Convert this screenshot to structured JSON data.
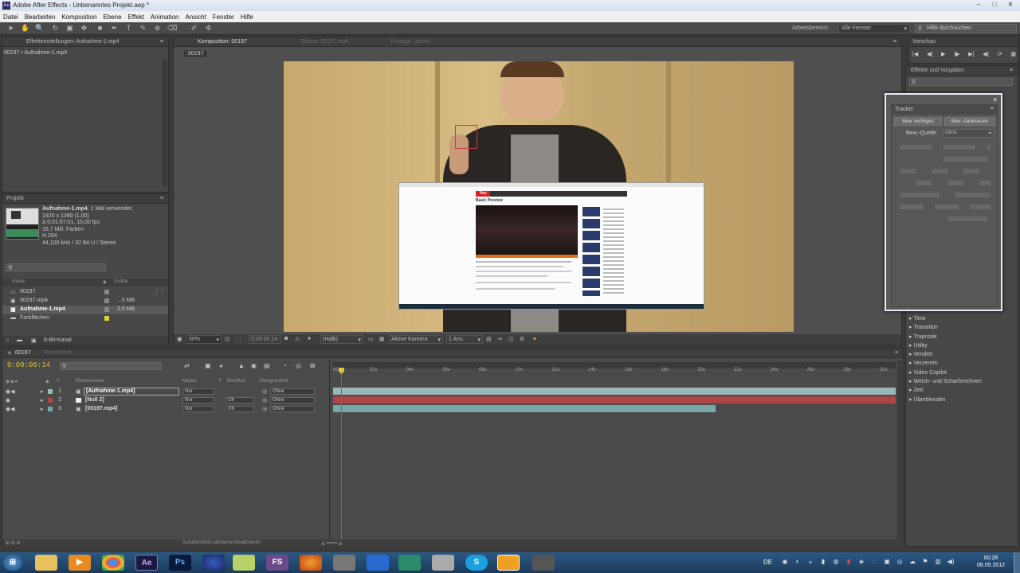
{
  "window": {
    "title": "Adobe After Effects - Unbenanntes Projekt.aep *",
    "app_icon": "Ae",
    "buttons": [
      "–",
      "□",
      "✕"
    ]
  },
  "menu": [
    "Datei",
    "Bearbeiten",
    "Komposition",
    "Ebene",
    "Effekt",
    "Animation",
    "Ansicht",
    "Fenster",
    "Hilfe"
  ],
  "toolbar": {
    "workspace_label": "Arbeitsbereich:",
    "workspace_value": "Alle Fenster",
    "help_placeholder": "Hilfe durchsuchen"
  },
  "effects_panel": {
    "tab": "Effekteinstellungen: Aufnahme-1.mp4",
    "subtitle": "00197 • Aufnahme-1.mp4"
  },
  "project": {
    "tab": "Projekt",
    "selected_name": "Aufnahme-1.mp4",
    "selected_usage": ", 1 Mal verwendet",
    "info": [
      "1920 x 1080 (1,00)",
      "Δ 0:01:07:01, 15,00 fps",
      "16,7 Mill. Farben",
      "H.264",
      "44,100 kHz / 32 Bit U / Stereo"
    ],
    "col_name": "Name",
    "col_size": "Größe",
    "items": [
      {
        "name": "00197",
        "size": ""
      },
      {
        "name": "00197.mp4",
        "size": "...5 MB"
      },
      {
        "name": "Aufnahme-1.mp4",
        "size": "3,5 MB"
      },
      {
        "name": "Farbflächen",
        "size": ""
      }
    ],
    "bit_depth": "8-Bit-Kanal"
  },
  "composition": {
    "tab": "Komposition: 00197",
    "tab2": "Ebene: 00197.mp4",
    "tab3": "Footage: (ohne)",
    "subtab": "00197",
    "zoom": "50%",
    "timecode": "0:00:00:14",
    "quality": "(Halb)",
    "camera": "Aktive Kamera",
    "views": "1 Ans.",
    "preview_site_title": "Basic Preview",
    "preview_logo": "You"
  },
  "preview_panel": {
    "tab": "Vorschau",
    "buttons": [
      "|◀",
      "◀|",
      "▶",
      "|▶",
      "▶|",
      "◀)",
      "⟳",
      "▦"
    ]
  },
  "effects_presets": {
    "tab": "Effekte und Vorgaben",
    "categories": [
      "Time",
      "Transition",
      "Trapcode",
      "Utility",
      "Veraltet",
      "Verzerren",
      "Video Copilot",
      "Weich- und Scharfzeichnen",
      "Zeit",
      "Überblenden"
    ]
  },
  "tracker": {
    "tab": "Tracker",
    "btn_track": "Bew. verfolgen",
    "btn_stabilize": "Bew. stabilisieren",
    "source_label": "Bew.-Quelle:",
    "source_value": "Ohne"
  },
  "timeline": {
    "tab": "00197",
    "tab2": "Renderliste",
    "timecode": "0:00:00:14",
    "col_layer": "Ebenenname",
    "col_mode": "Modus",
    "col_t": "T",
    "col_bewmas": "BewMas",
    "col_parent": "Übergeordnet",
    "ruler": [
      "00s",
      "02s",
      "04s",
      "06s",
      "08s",
      "10s",
      "12s",
      "14s",
      "16s",
      "18s",
      "20s",
      "22s",
      "24s",
      "26s",
      "28s",
      "30s"
    ],
    "layers": [
      {
        "num": "1",
        "name": "[Aufnahme-1.mp4]",
        "mode": "Nor",
        "bewmas": "",
        "parent": "Ohne",
        "color": "#9ab8b8"
      },
      {
        "num": "2",
        "name": "[Null 2]",
        "mode": "Nor",
        "bewmas": "Oh",
        "parent": "Ohne",
        "color": "#b04545"
      },
      {
        "num": "3",
        "name": "[00197.mp4]",
        "mode": "Nor",
        "bewmas": "Oh",
        "parent": "Ohne",
        "color": "#7aa7a7"
      }
    ],
    "footer": "Schalter/Modi aktivieren/deaktivieren"
  },
  "taskbar": {
    "apps": [
      "start-icon",
      "explorer-icon",
      "media-player-icon",
      "chrome-icon",
      "after-effects-icon",
      "photoshop-icon",
      "firefox-icon",
      "notepad-icon",
      "fraps-icon",
      "audacity-icon",
      "game-icon",
      "app-icon",
      "terminal-icon",
      "tool-icon",
      "skype-icon",
      "blender-icon",
      "misc-icon"
    ],
    "app_labels": [
      "",
      "",
      "▶",
      "",
      "Ae",
      "Ps",
      "",
      "",
      "FS",
      "",
      "",
      "",
      "",
      "",
      "S",
      "",
      ""
    ],
    "lang": "DE",
    "time": "00:26",
    "date": "06.05.2012"
  }
}
